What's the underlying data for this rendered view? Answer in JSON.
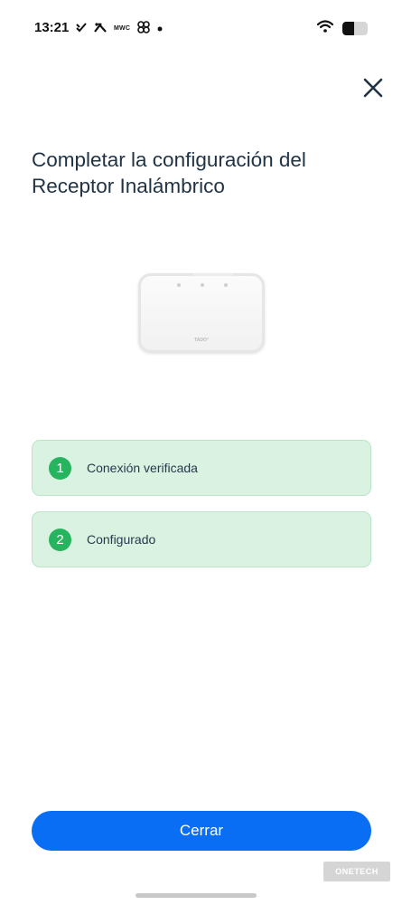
{
  "status_bar": {
    "time": "13:21",
    "left_icons": [
      "notification-check-icon",
      "caixabank-icon",
      "mwc-icon",
      "fan-icon",
      "dot-icon"
    ],
    "mwc_text": "MWC",
    "battery_level": 0.45
  },
  "title": "Completar la configuración del Receptor Inalámbrico",
  "device": {
    "logo_text": "TADO°"
  },
  "steps": [
    {
      "number": "1",
      "label": "Conexión verificada"
    },
    {
      "number": "2",
      "label": "Configurado"
    }
  ],
  "button": {
    "label": "Cerrar"
  },
  "watermark": {
    "text": "ONETECH"
  },
  "colors": {
    "accent": "#0a6ef5",
    "step_bg": "#d9f2e1",
    "step_badge": "#27b45e",
    "title": "#1f3345"
  }
}
